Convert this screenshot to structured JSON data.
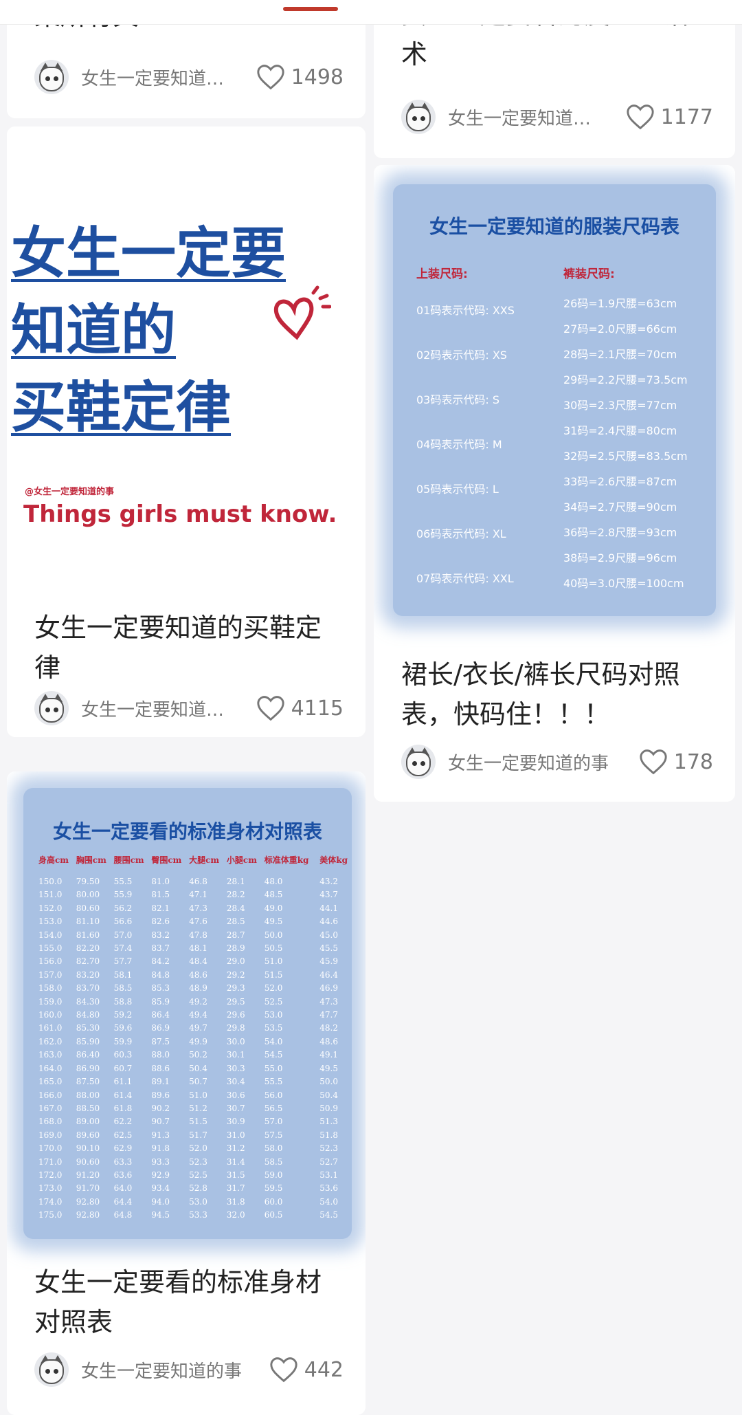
{
  "colors": {
    "accent": "#c0392b",
    "brand_blue": "#1e4fa0",
    "like_gray": "#777777"
  },
  "left_column": {
    "card1": {
      "title_partial": "某所有关!",
      "author": "女生一定要知道…",
      "likes": "1498",
      "avatar_icon": "cat-avatar-icon",
      "like_icon": "heart-outline-icon"
    },
    "card2": {
      "image": {
        "line1": "女生一定要",
        "line2": "知道的",
        "line3": "买鞋定律",
        "handle": "@女生一定要知道的事",
        "slogan": "Things girls must know.",
        "decor_icon": "red-heart-doodle-icon"
      },
      "title": "女生一定要知道的买鞋定律",
      "author": "女生一定要知道…",
      "likes": "4115"
    },
    "card3": {
      "image": {
        "title": "女生一定要看的标准身材对照表",
        "headers": [
          "身高cm",
          "胸围cm",
          "腰围cm",
          "臀围cm",
          "大腿cm",
          "小腿cm",
          "标准体重kg",
          "美体kg"
        ],
        "rows": [
          [
            "150.0",
            "79.50",
            "55.5",
            "81.0",
            "46.8",
            "28.1",
            "48.0",
            "43.2"
          ],
          [
            "151.0",
            "80.00",
            "55.9",
            "81.5",
            "47.1",
            "28.2",
            "48.5",
            "43.7"
          ],
          [
            "152.0",
            "80.60",
            "56.2",
            "82.1",
            "47.3",
            "28.4",
            "49.0",
            "44.1"
          ],
          [
            "153.0",
            "81.10",
            "56.6",
            "82.6",
            "47.6",
            "28.5",
            "49.5",
            "44.6"
          ],
          [
            "154.0",
            "81.60",
            "57.0",
            "83.2",
            "47.8",
            "28.7",
            "50.0",
            "45.0"
          ],
          [
            "155.0",
            "82.20",
            "57.4",
            "83.7",
            "48.1",
            "28.9",
            "50.5",
            "45.5"
          ],
          [
            "156.0",
            "82.70",
            "57.7",
            "84.2",
            "48.4",
            "29.0",
            "51.0",
            "45.9"
          ],
          [
            "157.0",
            "83.20",
            "58.1",
            "84.8",
            "48.6",
            "29.2",
            "51.5",
            "46.4"
          ],
          [
            "158.0",
            "83.70",
            "58.5",
            "85.3",
            "48.9",
            "29.3",
            "52.0",
            "46.9"
          ],
          [
            "159.0",
            "84.30",
            "58.8",
            "85.9",
            "49.2",
            "29.5",
            "52.5",
            "47.3"
          ],
          [
            "160.0",
            "84.80",
            "59.2",
            "86.4",
            "49.4",
            "29.6",
            "53.0",
            "47.7"
          ],
          [
            "161.0",
            "85.30",
            "59.6",
            "86.9",
            "49.7",
            "29.8",
            "53.5",
            "48.2"
          ],
          [
            "162.0",
            "85.90",
            "59.9",
            "87.5",
            "49.9",
            "30.0",
            "54.0",
            "48.6"
          ],
          [
            "163.0",
            "86.40",
            "60.3",
            "88.0",
            "50.2",
            "30.1",
            "54.5",
            "49.1"
          ],
          [
            "164.0",
            "86.90",
            "60.7",
            "88.6",
            "50.4",
            "30.3",
            "55.0",
            "49.5"
          ],
          [
            "165.0",
            "87.50",
            "61.1",
            "89.1",
            "50.7",
            "30.4",
            "55.5",
            "50.0"
          ],
          [
            "166.0",
            "88.00",
            "61.4",
            "89.6",
            "51.0",
            "30.6",
            "56.0",
            "50.4"
          ],
          [
            "167.0",
            "88.50",
            "61.8",
            "90.2",
            "51.2",
            "30.7",
            "56.5",
            "50.9"
          ],
          [
            "168.0",
            "89.00",
            "62.2",
            "90.7",
            "51.5",
            "30.9",
            "57.0",
            "51.3"
          ],
          [
            "169.0",
            "89.60",
            "62.5",
            "91.3",
            "51.7",
            "31.0",
            "57.5",
            "51.8"
          ],
          [
            "170.0",
            "90.10",
            "62.9",
            "91.8",
            "52.0",
            "31.2",
            "58.0",
            "52.3"
          ],
          [
            "171.0",
            "90.60",
            "63.3",
            "93.3",
            "52.3",
            "31.4",
            "58.5",
            "52.7"
          ],
          [
            "172.0",
            "91.20",
            "63.6",
            "92.9",
            "52.5",
            "31.5",
            "59.0",
            "53.1"
          ],
          [
            "173.0",
            "91.70",
            "64.0",
            "93.4",
            "52.8",
            "31.7",
            "59.5",
            "53.6"
          ],
          [
            "174.0",
            "92.80",
            "64.4",
            "94.0",
            "53.0",
            "31.8",
            "60.0",
            "54.0"
          ],
          [
            "175.0",
            "92.80",
            "64.8",
            "94.5",
            "53.3",
            "32.0",
            "60.5",
            "54.5"
          ]
        ]
      },
      "title": "女生一定要看的标准身材对照表",
      "author": "女生一定要知道的事",
      "likes": "442"
    }
  },
  "right_column": {
    "card1": {
      "title_partial_line1": "女生一定要看的皮PUA话",
      "title_partial_line2": "术",
      "author": "女生一定要知道…",
      "likes": "1177"
    },
    "card2": {
      "image": {
        "title": "女生一定要知道的服装尺码表",
        "top_heading": "上装尺码:",
        "bottom_heading": "裤装尺码:",
        "top_sizes": [
          "01码表示代码: XXS",
          "02码表示代码: XS",
          "03码表示代码: S",
          "04码表示代码: M",
          "05码表示代码: L",
          "06码表示代码: XL",
          "07码表示代码: XXL"
        ],
        "bottom_sizes": [
          "26码=1.9尺腰=63cm",
          "27码=2.0尺腰=66cm",
          "28码=2.1尺腰=70cm",
          "29码=2.2尺腰=73.5cm",
          "30码=2.3尺腰=77cm",
          "31码=2.4尺腰=80cm",
          "32码=2.5尺腰=83.5cm",
          "33码=2.6尺腰=87cm",
          "34码=2.7尺腰=90cm",
          "36码=2.8尺腰=93cm",
          "38码=2.9尺腰=96cm",
          "40码=3.0尺腰=100cm"
        ]
      },
      "title": "裙长/衣长/裤长尺码对照表，快码住！！！",
      "author": "女生一定要知道的事",
      "likes": "178"
    }
  }
}
